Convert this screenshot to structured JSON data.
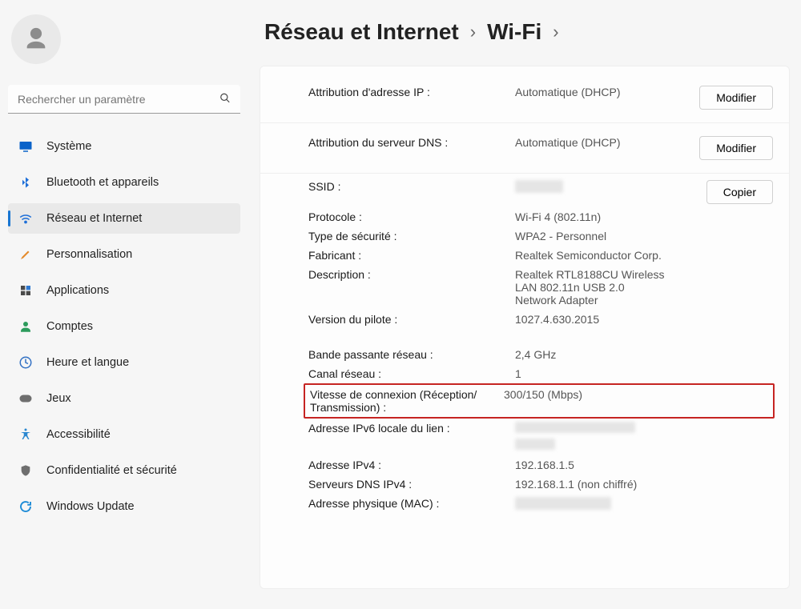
{
  "search": {
    "placeholder": "Rechercher un paramètre"
  },
  "sidebar": {
    "items": [
      {
        "label": "Système"
      },
      {
        "label": "Bluetooth et appareils"
      },
      {
        "label": "Réseau et Internet"
      },
      {
        "label": "Personnalisation"
      },
      {
        "label": "Applications"
      },
      {
        "label": "Comptes"
      },
      {
        "label": "Heure et langue"
      },
      {
        "label": "Jeux"
      },
      {
        "label": "Accessibilité"
      },
      {
        "label": "Confidentialité et sécurité"
      },
      {
        "label": "Windows Update"
      }
    ]
  },
  "breadcrumb": {
    "parent": "Réseau et Internet",
    "current": "Wi-Fi"
  },
  "buttons": {
    "modify": "Modifier",
    "copy": "Copier"
  },
  "props": {
    "ip_assign": {
      "label": "Attribution d'adresse IP :",
      "value": "Automatique (DHCP)"
    },
    "dns_assign": {
      "label": "Attribution du serveur DNS :",
      "value": "Automatique (DHCP)"
    },
    "ssid": {
      "label": "SSID :"
    },
    "protocol": {
      "label": "Protocole :",
      "value": "Wi-Fi 4 (802.11n)"
    },
    "security": {
      "label": "Type de sécurité :",
      "value": "WPA2 - Personnel"
    },
    "vendor": {
      "label": "Fabricant :",
      "value": "Realtek Semiconductor Corp."
    },
    "description": {
      "label": "Description :",
      "value": "Realtek RTL8188CU Wireless LAN 802.11n USB 2.0 Network Adapter"
    },
    "driver": {
      "label": "Version du pilote :",
      "value": "1027.4.630.2015"
    },
    "band": {
      "label": "Bande passante réseau :",
      "value": "2,4 GHz"
    },
    "channel": {
      "label": "Canal réseau :",
      "value": "1"
    },
    "speed": {
      "label": "Vitesse de connexion (Réception/ Transmission) :",
      "value": "300/150 (Mbps)"
    },
    "ipv6_local": {
      "label": "Adresse IPv6 locale du lien :"
    },
    "ipv4": {
      "label": "Adresse IPv4 :",
      "value": "192.168.1.5"
    },
    "dns_ipv4": {
      "label": "Serveurs DNS IPv4 :",
      "value": "192.168.1.1 (non chiffré)"
    },
    "mac": {
      "label": "Adresse physique (MAC) :"
    }
  }
}
